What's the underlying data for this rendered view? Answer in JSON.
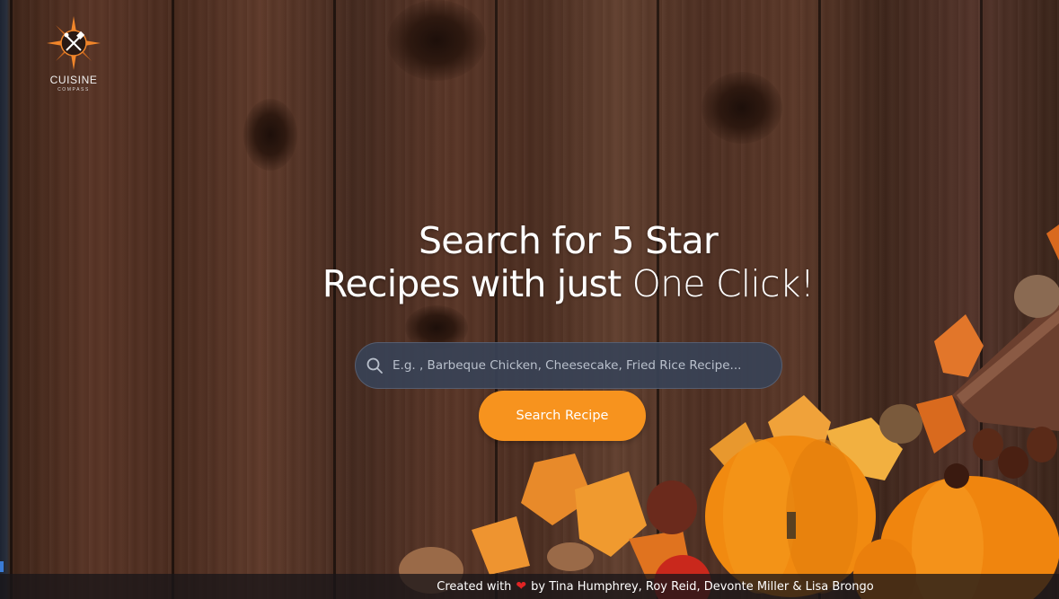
{
  "logo": {
    "title": "CUISINE",
    "subtitle": "COMPASS"
  },
  "hero": {
    "line1": "Search for 5 Star",
    "line2_regular": "Recipes with just ",
    "line2_light": "One Click!"
  },
  "search": {
    "placeholder": "E.g. , Barbeque Chicken, Cheesecake, Fried Rice Recipe...",
    "value": "",
    "icon": "search-icon"
  },
  "search_button": {
    "label": "Search Recipe"
  },
  "footer": {
    "prefix": "Created with",
    "icon": "heart-icon",
    "credits": "by Tina Humphrey, Roy Reid, Devonte Miller & Lisa Brongo"
  },
  "colors": {
    "accent": "#f7931e",
    "search_bg": "#384256",
    "heart": "#e02424"
  }
}
